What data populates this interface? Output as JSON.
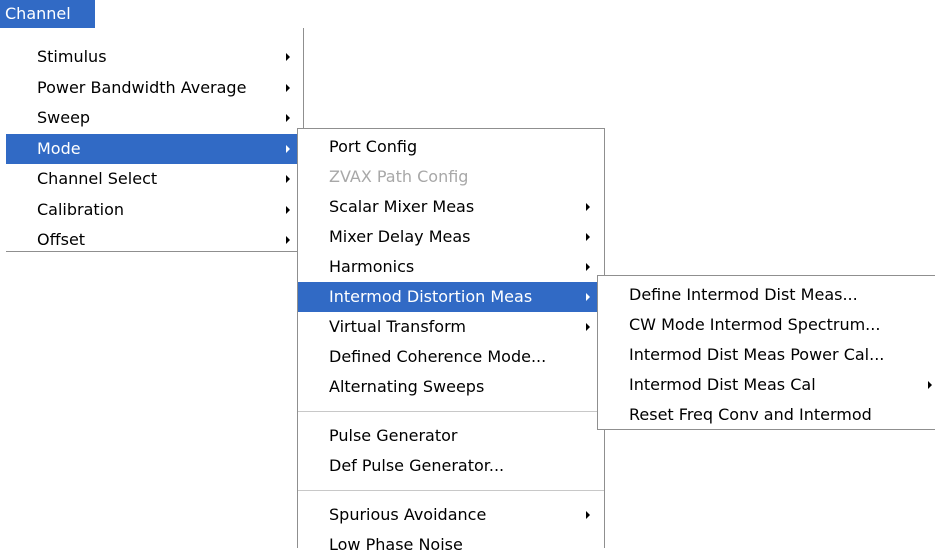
{
  "menubar": {
    "title": "Channel"
  },
  "menu_l1": {
    "items": [
      {
        "label": "Stimulus"
      },
      {
        "label": "Power Bandwidth Average"
      },
      {
        "label": "Sweep"
      },
      {
        "label": "Mode"
      },
      {
        "label": "Channel Select"
      },
      {
        "label": "Calibration"
      },
      {
        "label": "Offset"
      }
    ]
  },
  "menu_l2": {
    "items": [
      {
        "label": "Port Config"
      },
      {
        "label": "ZVAX Path Config"
      },
      {
        "label": "Scalar Mixer Meas"
      },
      {
        "label": "Mixer Delay Meas"
      },
      {
        "label": "Harmonics"
      },
      {
        "label": "Intermod Distortion Meas"
      },
      {
        "label": "Virtual Transform"
      },
      {
        "label": "Defined Coherence Mode..."
      },
      {
        "label": "Alternating Sweeps"
      },
      {
        "label": "Pulse Generator"
      },
      {
        "label": "Def Pulse Generator..."
      },
      {
        "label": "Spurious Avoidance"
      },
      {
        "label": "Low Phase Noise"
      }
    ]
  },
  "menu_l3": {
    "items": [
      {
        "label": "Define Intermod Dist Meas..."
      },
      {
        "label": "CW Mode Intermod Spectrum..."
      },
      {
        "label": "Intermod Dist Meas Power Cal..."
      },
      {
        "label": "Intermod Dist Meas Cal"
      },
      {
        "label": "Reset Freq Conv and Intermod"
      }
    ]
  },
  "colors": {
    "highlight": "#316ac5",
    "disabled_text": "#a8a8a8",
    "border": "#8f8f8f"
  }
}
